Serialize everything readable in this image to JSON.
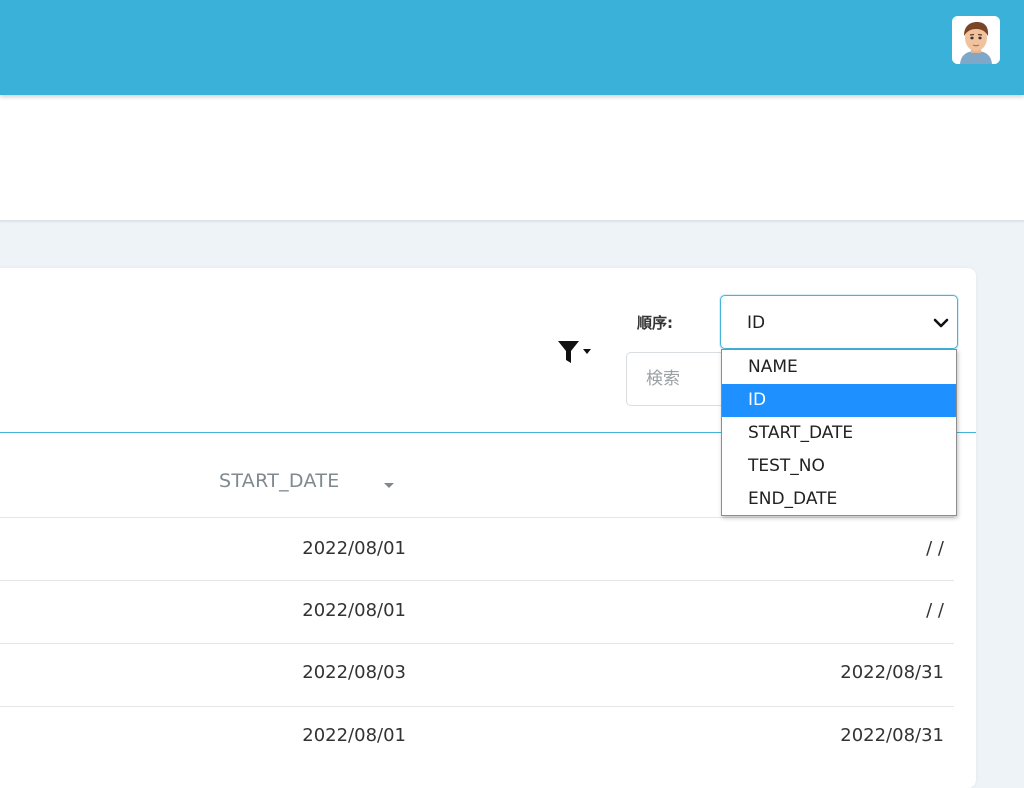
{
  "header": {
    "avatar_icon": "user-avatar-icon",
    "accent_color": "#3ab1d8"
  },
  "toolbar": {
    "filter_icon": "filter-icon",
    "order_label": "順序:",
    "order_selected": "ID",
    "order_options": [
      "NAME",
      "ID",
      "START_DATE",
      "TEST_NO",
      "END_DATE"
    ],
    "search_placeholder": "検索"
  },
  "table": {
    "columns": [
      "START_DATE"
    ],
    "rows": [
      {
        "start_date": "2022/08/01",
        "end_date": "/ /"
      },
      {
        "start_date": "2022/08/01",
        "end_date": "/ /"
      },
      {
        "start_date": "2022/08/03",
        "end_date": "2022/08/31"
      },
      {
        "start_date": "2022/08/01",
        "end_date": "2022/08/31"
      }
    ]
  }
}
